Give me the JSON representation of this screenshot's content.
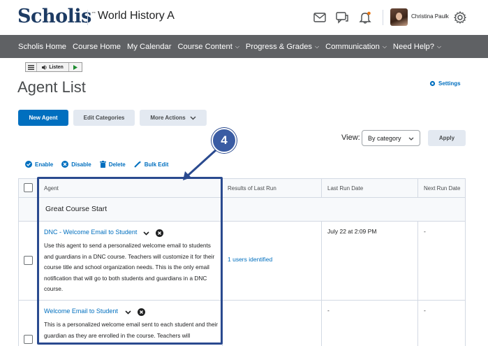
{
  "header": {
    "logo": "Scholis",
    "logo_tm": "™",
    "course_title": "World History A",
    "user_name": "Christina Paulk"
  },
  "nav": {
    "items": [
      {
        "label": "Scholis Home",
        "caret": false
      },
      {
        "label": "Course Home",
        "caret": false
      },
      {
        "label": "My Calendar",
        "caret": false
      },
      {
        "label": "Course Content",
        "caret": true
      },
      {
        "label": "Progress & Grades",
        "caret": true
      },
      {
        "label": "Communication",
        "caret": true
      },
      {
        "label": "Need Help?",
        "caret": true
      }
    ]
  },
  "listen": {
    "label": "Listen"
  },
  "page": {
    "title": "Agent List",
    "settings_label": "Settings"
  },
  "buttons": {
    "new_agent": "New Agent",
    "edit_categories": "Edit Categories",
    "more_actions": "More Actions",
    "apply": "Apply"
  },
  "view": {
    "label": "View:",
    "selected": "By category"
  },
  "actions": {
    "enable": "Enable",
    "disable": "Disable",
    "delete": "Delete",
    "bulk_edit": "Bulk Edit"
  },
  "table": {
    "headers": {
      "agent": "Agent",
      "results": "Results of Last Run",
      "last_run": "Last Run Date",
      "next_run": "Next Run Date"
    },
    "category": "Great Course Start",
    "rows": [
      {
        "name": "DNC - Welcome Email to Student",
        "description": "Use this agent to send a personalized welcome email to students and guardians in a DNC course. Teachers will customize it for their course title and school organization needs. This is the only email notification that will go to both students and guardians in a DNC course.",
        "results": "1 users identified",
        "last_run": "July 22 at 2:09 PM",
        "next_run": "-"
      },
      {
        "name": "Welcome Email to Student",
        "description": "This is a personalized welcome email sent to each student and their guardian as they are enrolled in the course. Teachers will",
        "results": "",
        "last_run": "-",
        "next_run": "-"
      }
    ]
  },
  "callout": {
    "number": "4"
  },
  "colors": {
    "brand": "#1d3b63",
    "link": "#006fbf",
    "navbar": "#5f6164",
    "callout": "#2a4a8f"
  }
}
